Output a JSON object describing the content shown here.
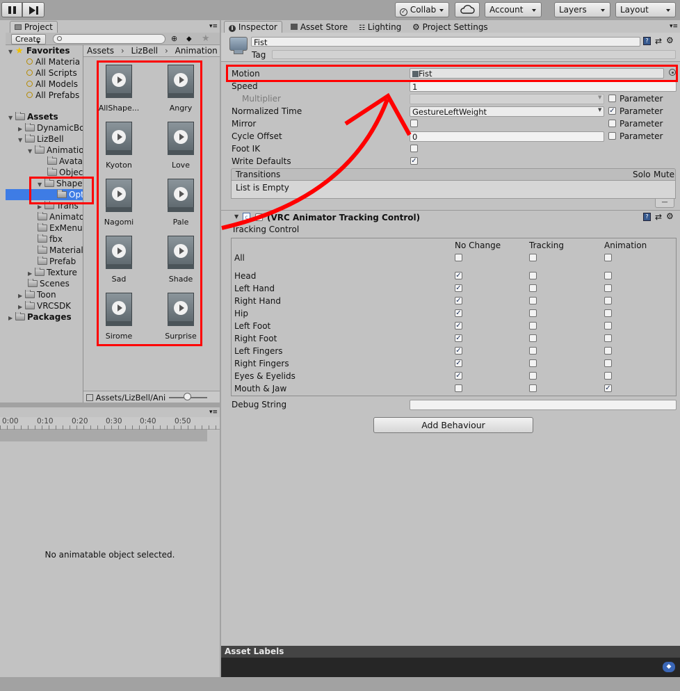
{
  "toolbar": {
    "collab_label": "Collab",
    "account_label": "Account",
    "layers_label": "Layers",
    "layout_label": "Layout"
  },
  "project": {
    "tab_label": "Project",
    "create_label": "Create",
    "search_placeholder": "",
    "favorites": {
      "title": "Favorites",
      "items": [
        "All Materia",
        "All Scripts",
        "All Models",
        "All Prefabs"
      ]
    },
    "tree": [
      {
        "label": "Assets",
        "bold": true
      },
      {
        "label": "DynamicBo"
      },
      {
        "label": "LizBell"
      },
      {
        "label": "Animatio"
      },
      {
        "label": "Avata"
      },
      {
        "label": "Objec"
      },
      {
        "label": "Shape"
      },
      {
        "label": "Opt"
      },
      {
        "label": "Trans"
      },
      {
        "label": "Animato"
      },
      {
        "label": "ExMenu"
      },
      {
        "label": "fbx"
      },
      {
        "label": "Material"
      },
      {
        "label": "Prefab"
      },
      {
        "label": "Texture"
      },
      {
        "label": "Scenes"
      },
      {
        "label": "Toon"
      },
      {
        "label": "VRCSDK"
      },
      {
        "label": "Packages",
        "bold": true
      }
    ],
    "breadcrumb": [
      "Assets",
      "LizBell",
      "Animation"
    ],
    "assets": [
      "AllShape...",
      "Angry",
      "Kyoton",
      "Love",
      "Nagomi",
      "Pale",
      "Sad",
      "Shade",
      "Sirome",
      "Surprise"
    ],
    "path_bar": "Assets/LizBell/Ani"
  },
  "animation": {
    "ticks": [
      "0:00",
      "0:10",
      "0:20",
      "0:30",
      "0:40",
      "0:50"
    ],
    "empty_message": "No animatable object selected."
  },
  "inspector": {
    "tabs": [
      "Inspector",
      "Asset Store",
      "Lighting",
      "Project Settings"
    ],
    "name_value": "Fist",
    "tag_label": "Tag",
    "motion_label": "Motion",
    "motion_value": "Fist",
    "speed_label": "Speed",
    "speed_value": "1",
    "multiplier_label": "Multiplier",
    "normalized_time_label": "Normalized Time",
    "normalized_time_value": "GestureLeftWeight",
    "mirror_label": "Mirror",
    "cycle_offset_label": "Cycle Offset",
    "cycle_offset_value": "0",
    "foot_ik_label": "Foot IK",
    "write_defaults_label": "Write Defaults",
    "parameter_label": "Parameter",
    "transitions_label": "Transitions",
    "solo_label": "Solo",
    "mute_label": "Mute",
    "list_empty": "List is Empty",
    "list_minus": "—",
    "component_title": "(VRC Animator Tracking Control)",
    "tracking_control_label": "Tracking Control",
    "columns": [
      "No Change",
      "Tracking",
      "Animation"
    ],
    "tracking_rows": [
      {
        "label": "All",
        "state": ""
      },
      {
        "label": "Head",
        "state": "no_change"
      },
      {
        "label": "Left Hand",
        "state": "no_change"
      },
      {
        "label": "Right Hand",
        "state": "no_change"
      },
      {
        "label": "Hip",
        "state": "no_change"
      },
      {
        "label": "Left Foot",
        "state": "no_change"
      },
      {
        "label": "Right Foot",
        "state": "no_change"
      },
      {
        "label": "Left Fingers",
        "state": "no_change"
      },
      {
        "label": "Right Fingers",
        "state": "no_change"
      },
      {
        "label": "Eyes & Eyelids",
        "state": "no_change"
      },
      {
        "label": "Mouth & Jaw",
        "state": "animation"
      }
    ],
    "debug_string_label": "Debug String",
    "add_behaviour_label": "Add Behaviour",
    "asset_labels_title": "Asset Labels"
  },
  "colors": {
    "annotation_red": "#ff0000",
    "selection_blue": "#3e7ce5",
    "check_color": "#1c2f57"
  }
}
